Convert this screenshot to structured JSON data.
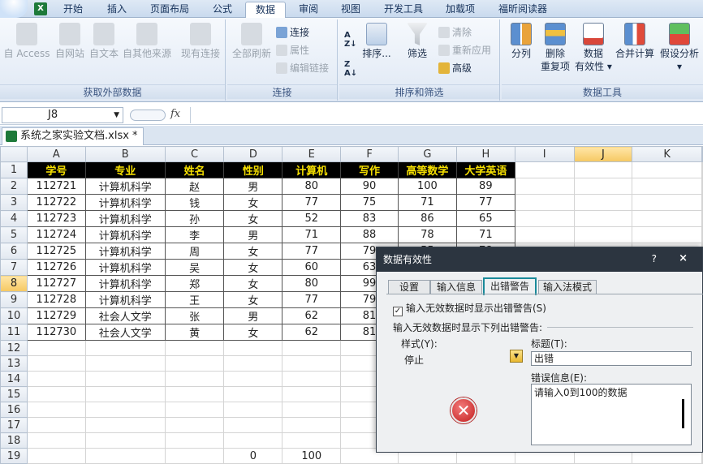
{
  "tabs": [
    {
      "label": "开始"
    },
    {
      "label": "插入"
    },
    {
      "label": "页面布局"
    },
    {
      "label": "公式"
    },
    {
      "label": "数据"
    },
    {
      "label": "审阅"
    },
    {
      "label": "视图"
    },
    {
      "label": "开发工具"
    },
    {
      "label": "加载项"
    },
    {
      "label": "福昕阅读器"
    }
  ],
  "ribbon": {
    "get_external": {
      "label": "获取外部数据",
      "access": "自 Access",
      "web": "自网站",
      "text": "自文本",
      "other": "自其他来源",
      "existing": "现有连接"
    },
    "connections": {
      "label": "连接",
      "refresh_all": "全部刷新",
      "connections": "连接",
      "properties": "属性",
      "edit_links": "编辑链接"
    },
    "sort_filter": {
      "label": "排序和筛选",
      "sort": "排序...",
      "filter": "筛选",
      "clear": "清除",
      "reapply": "重新应用",
      "advanced": "高级"
    },
    "data_tools": {
      "label": "数据工具",
      "split": "分列",
      "remove_dup_1": "删除",
      "remove_dup_2": "重复项",
      "validation_1": "数据",
      "validation_2": "有效性",
      "consolidate": "合并计算",
      "whatif": "假设分析"
    }
  },
  "formula_bar": {
    "name_box": "J8",
    "fx": "fx"
  },
  "file_tab": "系统之家实验文档.xlsx *",
  "columns": [
    "A",
    "B",
    "C",
    "D",
    "E",
    "F",
    "G",
    "H",
    "I",
    "J",
    "K"
  ],
  "selected_column": "J",
  "selected_row": "8",
  "headers": [
    "学号",
    "专业",
    "姓名",
    "性别",
    "计算机",
    "写作",
    "高等数学",
    "大学英语"
  ],
  "rows": [
    [
      "112721",
      "计算机科学",
      "赵",
      "男",
      "80",
      "90",
      "100",
      "89"
    ],
    [
      "112722",
      "计算机科学",
      "钱",
      "女",
      "77",
      "75",
      "71",
      "77"
    ],
    [
      "112723",
      "计算机科学",
      "孙",
      "女",
      "52",
      "83",
      "86",
      "65"
    ],
    [
      "112724",
      "计算机科学",
      "李",
      "男",
      "71",
      "88",
      "78",
      "71"
    ],
    [
      "112725",
      "计算机科学",
      "周",
      "女",
      "77",
      "79",
      "55",
      "78"
    ],
    [
      "112726",
      "计算机科学",
      "吴",
      "女",
      "60",
      "63",
      "",
      ""
    ],
    [
      "112727",
      "计算机科学",
      "郑",
      "女",
      "80",
      "99",
      "",
      ""
    ],
    [
      "112728",
      "计算机科学",
      "王",
      "女",
      "77",
      "79",
      "",
      ""
    ],
    [
      "112729",
      "社会人文学",
      "张",
      "男",
      "62",
      "81",
      "",
      ""
    ],
    [
      "112730",
      "社会人文学",
      "黄",
      "女",
      "62",
      "81",
      "",
      ""
    ]
  ],
  "row19": {
    "D": "0",
    "E": "100"
  },
  "dialog": {
    "title": "数据有效性",
    "help": "?",
    "close": "×",
    "tabs": [
      "设置",
      "输入信息",
      "出错警告",
      "输入法模式"
    ],
    "active_tab": "出错警告",
    "show_alert_label": "输入无效数据时显示出错警告(S)",
    "section_label": "输入无效数据时显示下列出错警告:",
    "style_label": "样式(Y):",
    "style_value": "停止",
    "title_label": "标题(T):",
    "title_value": "出错",
    "message_label": "错误信息(E):",
    "message_value": "请输入0到100的数据",
    "error_icon_symbol": "✕"
  },
  "colors": {
    "header_bg": "#000000",
    "header_text": "#f6e000",
    "selected_header": "#f5c862",
    "dialog_title_bg": "#2c3540",
    "active_tab_border": "#1a8a9a"
  }
}
